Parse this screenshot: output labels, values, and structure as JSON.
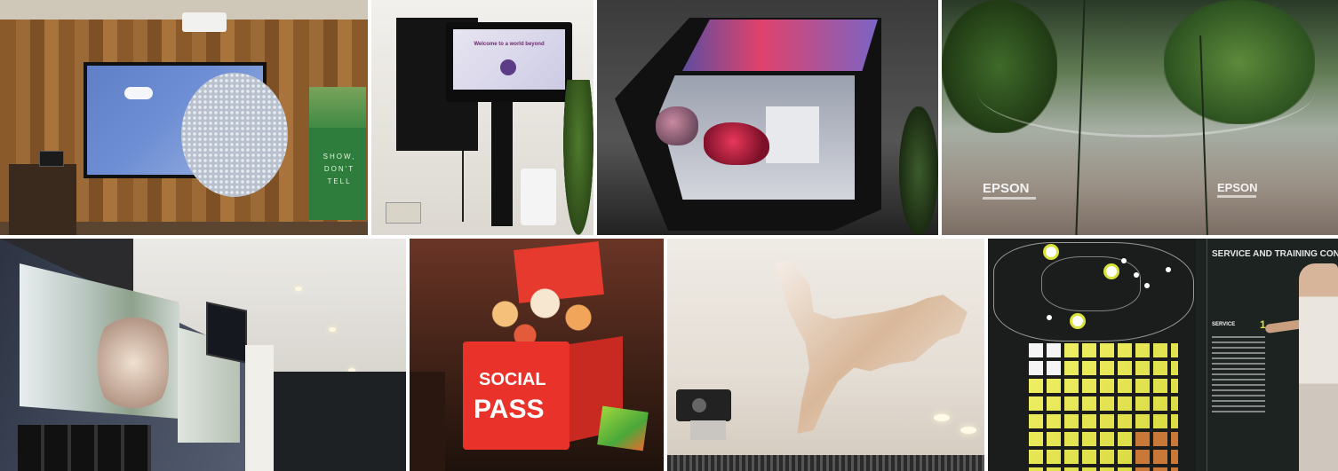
{
  "tiles": {
    "banner": {
      "text": "SHOW, DON'T TELL"
    },
    "kiosk": {
      "screen_title": "Welcome to a world beyond",
      "screen_subtitle": ""
    },
    "epson": {
      "logo_left": "EPSON",
      "logo_right": "EPSON"
    },
    "social": {
      "line1": "SOCIAL",
      "line2": "PASS"
    },
    "service": {
      "title": "SERVICE AND TRAINING CONC",
      "service_label": "SERVICE",
      "service_number": "1"
    }
  },
  "colors": {
    "epson_logo": "#f3f3f3",
    "social_red": "#e8322a",
    "accent_yellow": "#d9e23b",
    "banner_green": "#2f7d3c"
  }
}
